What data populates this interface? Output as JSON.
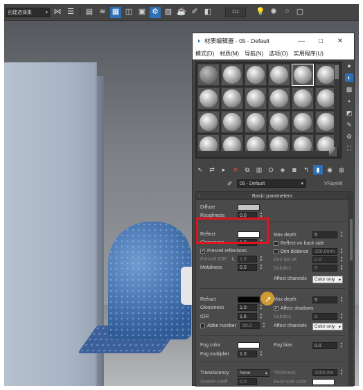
{
  "toolbar": {
    "combo_label": "创建选择集",
    "counter": "111",
    "icons": [
      "mirror-icon",
      "align-icon",
      "layer-icon",
      "scene-explorer-icon",
      "curve-editor-icon",
      "schematic-icon",
      "material-editor-icon",
      "render-setup-icon",
      "render-frame-icon",
      "render-icon",
      "teapot-icon",
      "lamp-icon",
      "sun-icon",
      "dots-icon"
    ]
  },
  "window": {
    "title": "材质编辑器 - 05 - Default",
    "minimize": "—",
    "maximize": "□",
    "close": "✕"
  },
  "menu": [
    "模式(D)",
    "材质(M)",
    "导航(N)",
    "选项(O)",
    "实用程序(U)"
  ],
  "material": {
    "name": "05 - Default",
    "type": "VRayMtl"
  },
  "basic_parameters": {
    "title": "Basic parameters",
    "collapse": "-",
    "diffuse": {
      "label": "Diffuse",
      "color": "#c4c4c4"
    },
    "roughness": {
      "label": "Roughness",
      "value": "0.0"
    },
    "reflect": {
      "label": "Reflect",
      "color": "#ffffff"
    },
    "glossiness": {
      "label": "Glossiness",
      "value": "1.0"
    },
    "fresnel": {
      "label": "Fresnel reflections",
      "checked": true
    },
    "fresnel_ior": {
      "label": "Fresnel IOR",
      "lock": "L",
      "value": "1.6"
    },
    "metalness": {
      "label": "Metalness",
      "value": "0.0"
    },
    "max_depth": {
      "label": "Max depth",
      "value": "5"
    },
    "reflect_back": {
      "label": "Reflect on back side",
      "checked": false
    },
    "dim_distance": {
      "label": "Dim distance",
      "value": "100.0mm",
      "checked": false
    },
    "dim_falloff": {
      "label": "Dim fall off",
      "value": "0.0"
    },
    "subdivs": {
      "label": "Subdivs",
      "value": "8"
    },
    "affect_channels": {
      "label": "Affect channels",
      "value": "Color only"
    },
    "refract": {
      "label": "Refract",
      "color": "#050505"
    },
    "refr_glossiness": {
      "label": "Glossiness",
      "value": "1.0"
    },
    "ior": {
      "label": "IOR",
      "value": "1.6"
    },
    "abbe": {
      "label": "Abbe number",
      "value": "50.0",
      "checked": false
    },
    "refr_max_depth": {
      "label": "Max depth",
      "value": "5"
    },
    "affect_shadows": {
      "label": "Affect shadows",
      "checked": true
    },
    "refr_subdivs": {
      "label": "Subdivs",
      "value": "8"
    },
    "refr_affect_channels": {
      "label": "Affect channels",
      "value": "Color only"
    },
    "fog_color": {
      "label": "Fog color",
      "color": "#ffffff"
    },
    "fog_multiplier": {
      "label": "Fog multiplier",
      "value": "1.0"
    },
    "fog_bias": {
      "label": "Fog bias",
      "value": "0.0"
    },
    "translucency": {
      "label": "Translucency",
      "value": "None"
    },
    "thickness": {
      "label": "Thickness",
      "value": "1000.0m"
    },
    "scatter_coeff": {
      "label": "Scatter coeff",
      "value": "0.0"
    },
    "back_side_color": {
      "label": "Back-side color",
      "color": "#ffffff"
    }
  },
  "colors": {
    "accent_blue": "#2f6fb3",
    "highlight_red": "#e0141e",
    "cursor_orange": "#e8a82e"
  }
}
